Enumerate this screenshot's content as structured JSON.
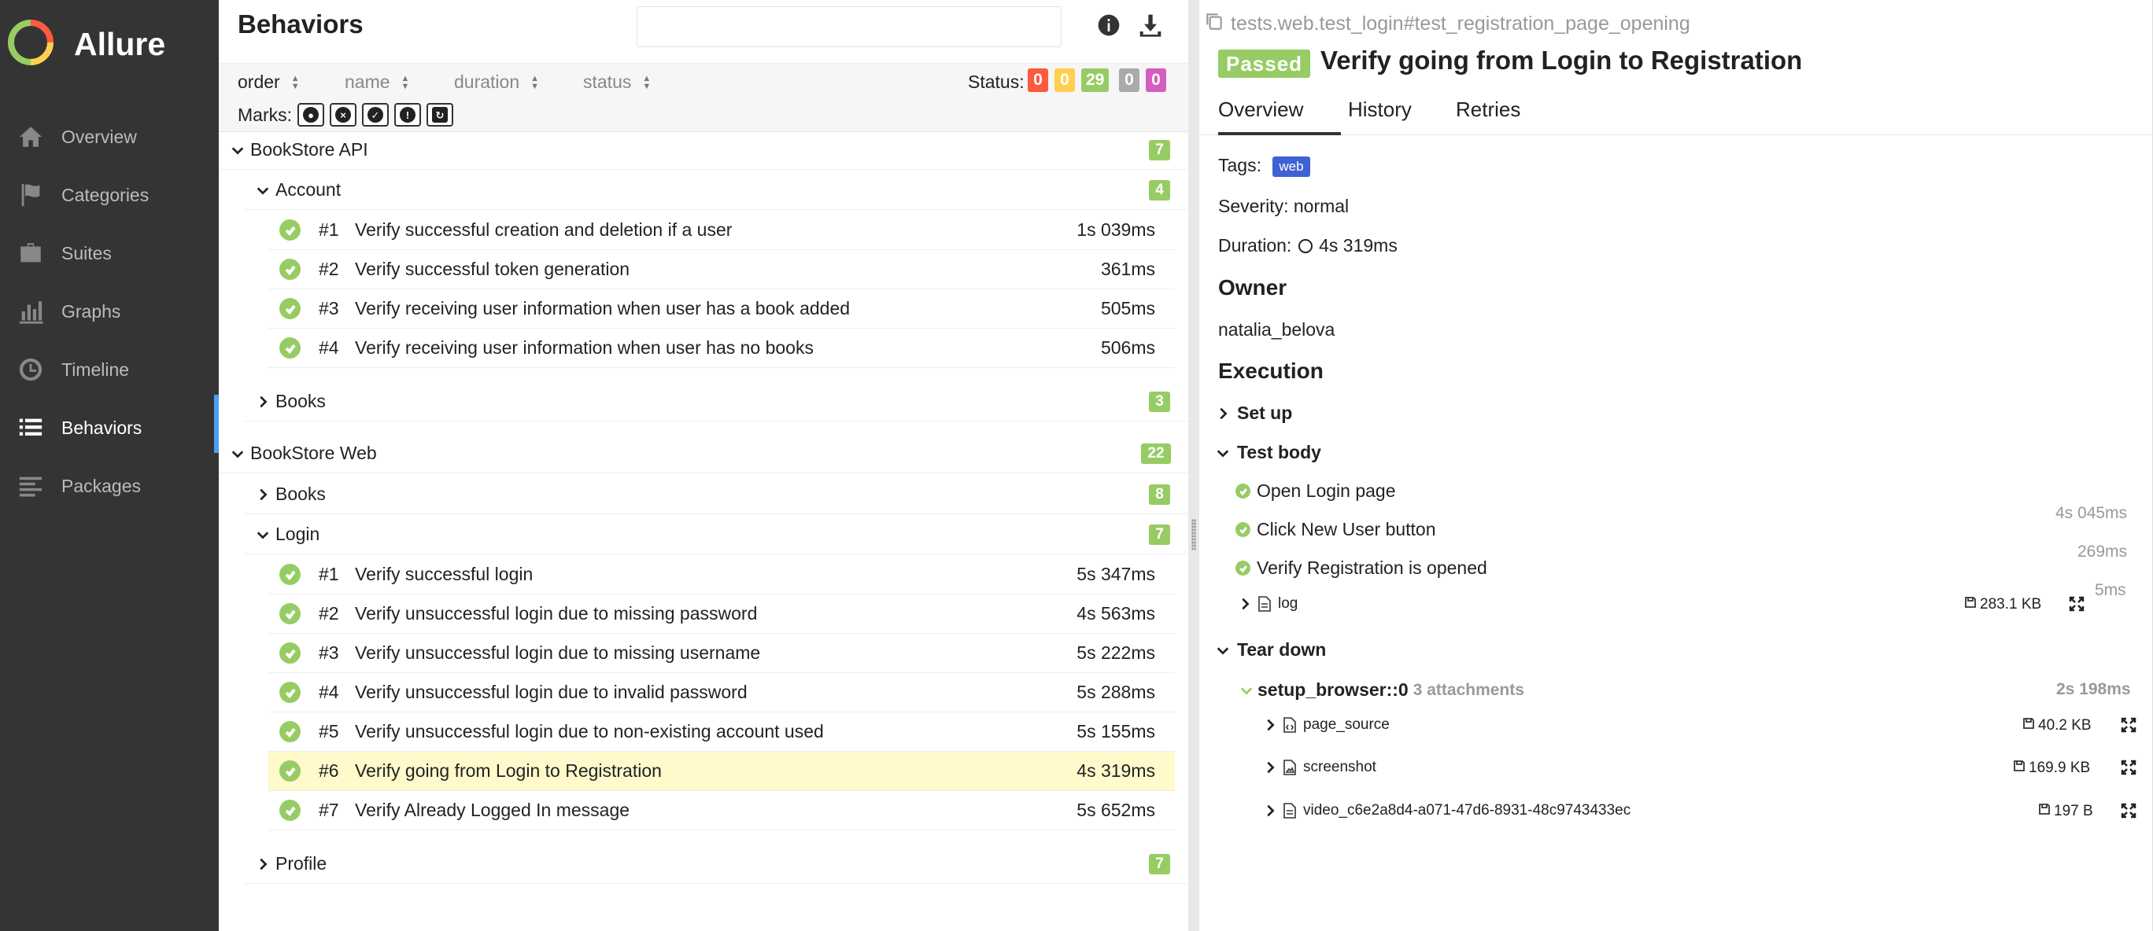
{
  "app": {
    "name": "Allure"
  },
  "sidebar": {
    "items": [
      {
        "label": "Overview",
        "icon": "home-icon"
      },
      {
        "label": "Categories",
        "icon": "flag-icon"
      },
      {
        "label": "Suites",
        "icon": "briefcase-icon"
      },
      {
        "label": "Graphs",
        "icon": "bar-chart-icon"
      },
      {
        "label": "Timeline",
        "icon": "clock-icon"
      },
      {
        "label": "Behaviors",
        "icon": "list-icon",
        "active": true
      },
      {
        "label": "Packages",
        "icon": "align-left-icon"
      }
    ]
  },
  "behaviors": {
    "title": "Behaviors",
    "search": {
      "value": "",
      "placeholder": ""
    },
    "sort": {
      "order": "order",
      "name": "name",
      "duration": "duration",
      "status": "status"
    },
    "status_label": "Status:",
    "status_counts": [
      {
        "value": "0",
        "color": "#fd5a3e"
      },
      {
        "value": "0",
        "color": "#ffd050"
      },
      {
        "value": "29",
        "color": "#97cc64"
      },
      {
        "value": "0",
        "color": "#aaaaaa"
      },
      {
        "value": "0",
        "color": "#d35ebe"
      }
    ],
    "marks_label": "Marks:",
    "marks": [
      "flaky-mark",
      "new-failed-mark",
      "new-passed-mark",
      "new-broken-mark",
      "retries-mark"
    ],
    "tree": {
      "bookstore_api": {
        "label": "BookStore API",
        "count": "7"
      },
      "account": {
        "label": "Account",
        "count": "4"
      },
      "account_cases": [
        {
          "num": "#1",
          "name": "Verify successful creation and deletion if a user",
          "dur": "1s 039ms"
        },
        {
          "num": "#2",
          "name": "Verify successful token generation",
          "dur": "361ms"
        },
        {
          "num": "#3",
          "name": "Verify receiving user information when user has a book added",
          "dur": "505ms"
        },
        {
          "num": "#4",
          "name": "Verify receiving user information when user has no books",
          "dur": "506ms"
        }
      ],
      "books_api": {
        "label": "Books",
        "count": "3"
      },
      "bookstore_web": {
        "label": "BookStore Web",
        "count": "22"
      },
      "books_web": {
        "label": "Books",
        "count": "8"
      },
      "login": {
        "label": "Login",
        "count": "7"
      },
      "login_cases": [
        {
          "num": "#1",
          "name": "Verify successful login",
          "dur": "5s 347ms"
        },
        {
          "num": "#2",
          "name": "Verify unsuccessful login due to missing password",
          "dur": "4s 563ms"
        },
        {
          "num": "#3",
          "name": "Verify unsuccessful login due to missing username",
          "dur": "5s 222ms"
        },
        {
          "num": "#4",
          "name": "Verify unsuccessful login due to invalid password",
          "dur": "5s 288ms"
        },
        {
          "num": "#5",
          "name": "Verify unsuccessful login due to non-existing account used",
          "dur": "5s 155ms"
        },
        {
          "num": "#6",
          "name": "Verify going from Login to Registration",
          "dur": "4s 319ms",
          "selected": true
        },
        {
          "num": "#7",
          "name": "Verify Already Logged In message",
          "dur": "5s 652ms"
        }
      ],
      "profile": {
        "label": "Profile",
        "count": "7"
      }
    }
  },
  "detail": {
    "path": "tests.web.test_login#test_registration_page_opening",
    "status": "Passed",
    "title": "Verify going from Login to Registration",
    "tabs": [
      "Overview",
      "History",
      "Retries"
    ],
    "tags_label": "Tags:",
    "tag": "web",
    "severity": "Severity: normal",
    "duration_label": "Duration:",
    "duration": "4s 319ms",
    "owner_heading": "Owner",
    "owner": "natalia_belova",
    "execution_heading": "Execution",
    "setup": "Set up",
    "test_body": "Test body",
    "steps": [
      {
        "name": "Open Login page",
        "dur": "4s 045ms"
      },
      {
        "name": "Click New User button",
        "dur": "269ms"
      },
      {
        "name": "Verify Registration is opened",
        "dur": "5ms"
      }
    ],
    "log": {
      "name": "log",
      "size": "283.1 KB"
    },
    "teardown": "Tear down",
    "fixture": {
      "name": "setup_browser::0",
      "attachments": "3 attachments",
      "dur": "2s 198ms"
    },
    "attachments": [
      {
        "name": "page_source",
        "size": "40.2 KB"
      },
      {
        "name": "screenshot",
        "size": "169.9 KB"
      },
      {
        "name": "video_c6e2a8d4-a071-47d6-8931-48c9743433ec",
        "size": "197 B"
      }
    ]
  }
}
